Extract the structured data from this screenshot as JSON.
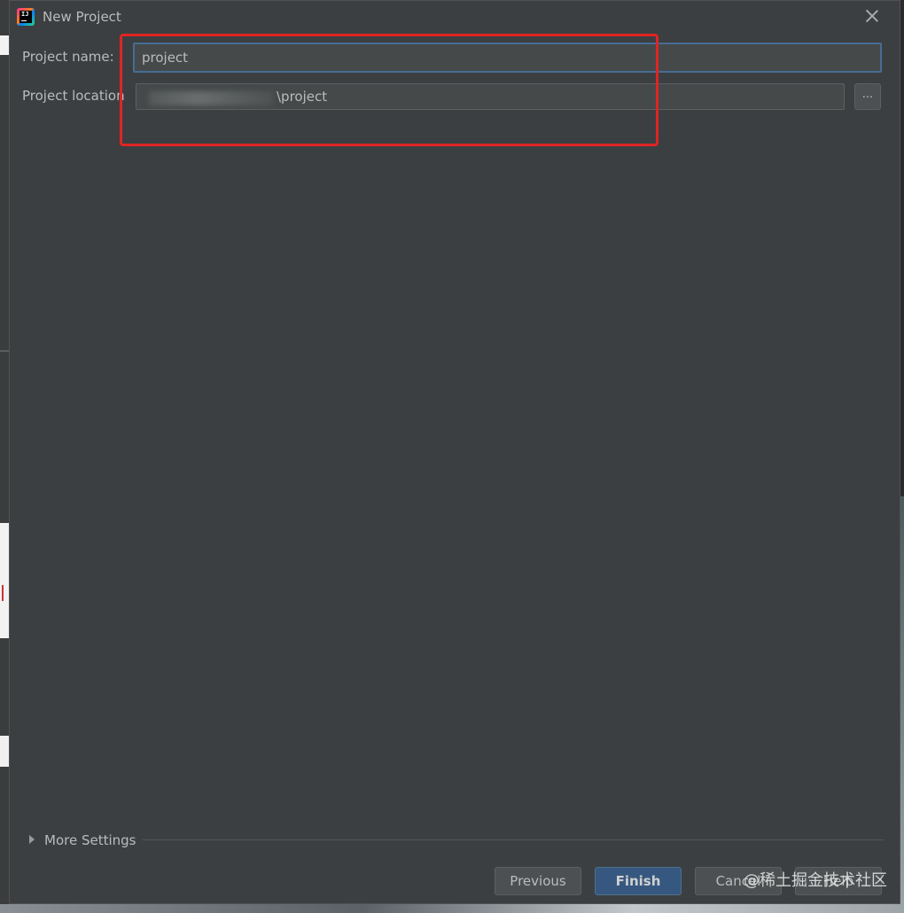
{
  "dialog": {
    "title": "New Project",
    "app_icon": "intellij-idea-icon",
    "close_icon": "close-icon"
  },
  "form": {
    "project_name_label": "Project name:",
    "project_name_value": "project",
    "project_location_label": "Project location",
    "project_location_value": "\\project",
    "browse_label": "..."
  },
  "more_settings": {
    "label": "More Settings",
    "expanded": false,
    "icon": "triangle-right-icon"
  },
  "buttons": {
    "previous": "Previous",
    "finish": "Finish",
    "cancel": "Cancel",
    "help": "Help"
  },
  "annotation": {
    "color": "#e02424"
  },
  "watermark": {
    "text": "@稀土掘金技术社区"
  },
  "colors": {
    "dialog_bg": "#3c3f41",
    "focus_border": "#466d94",
    "default_button": "#365880"
  }
}
